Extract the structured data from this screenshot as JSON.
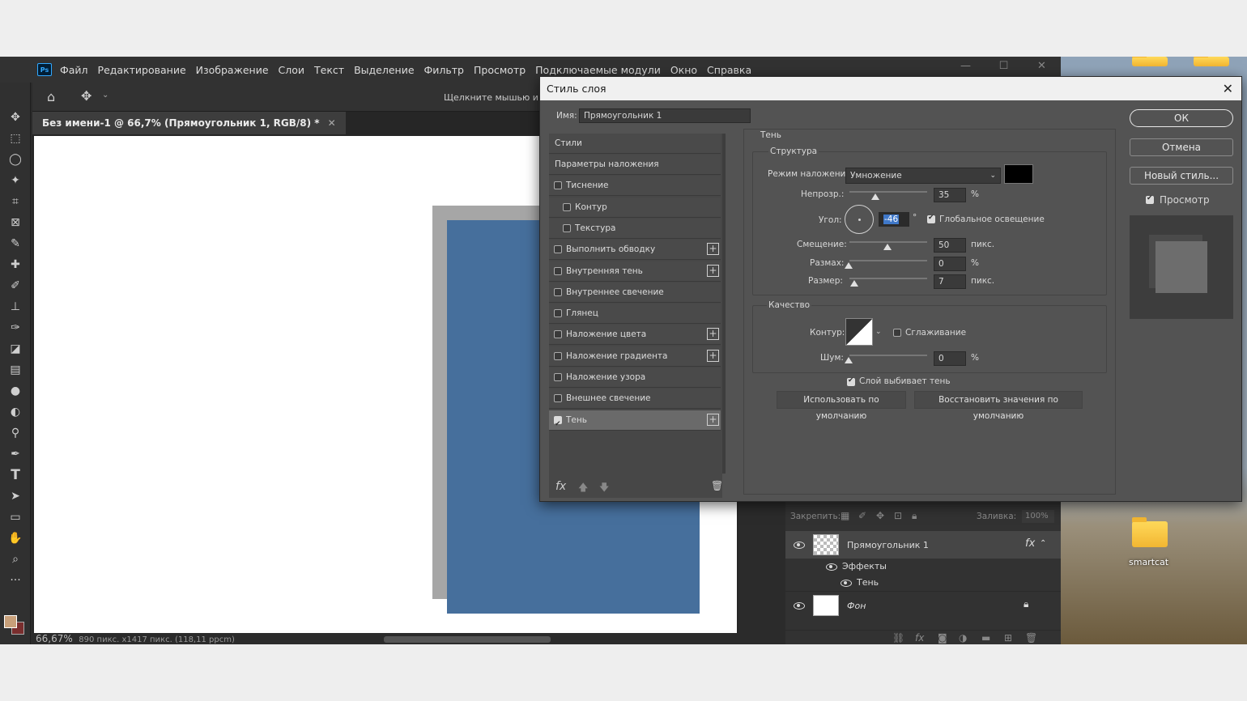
{
  "app": {
    "menu": [
      "Файл",
      "Редактирование",
      "Изображение",
      "Слои",
      "Текст",
      "Выделение",
      "Фильтр",
      "Просмотр",
      "Подключаемые модули",
      "Окно",
      "Справка"
    ],
    "options_hint": "Щелкните мышью и пере",
    "doc_tab": "Без имени-1 @ 66,7% (Прямоугольник 1, RGB/8) *",
    "status_zoom": "66,67%",
    "status_info": "890 пикс. x1417 пикс. (118,11 ppcm)"
  },
  "desktop": {
    "folder_label": "smartcat"
  },
  "layers": {
    "lock_label": "Закрепить:",
    "fill_label": "Заливка:",
    "fill_value": "100%",
    "items": [
      {
        "name": "Прямоугольник 1"
      },
      {
        "name": "Эффекты"
      },
      {
        "name": "Тень"
      },
      {
        "name": "Фон"
      }
    ]
  },
  "dialog": {
    "title": "Стиль слоя",
    "name_label": "Имя:",
    "name_value": "Прямоугольник 1",
    "styles": [
      {
        "label": "Стили"
      },
      {
        "label": "Параметры наложения"
      },
      {
        "label": "Тиснение",
        "checked": false
      },
      {
        "label": "Контур",
        "checked": false
      },
      {
        "label": "Текстура",
        "checked": false
      },
      {
        "label": "Выполнить обводку",
        "checked": false
      },
      {
        "label": "Внутренняя тень",
        "checked": false
      },
      {
        "label": "Внутреннее свечение",
        "checked": false
      },
      {
        "label": "Глянец",
        "checked": false
      },
      {
        "label": "Наложение цвета",
        "checked": false
      },
      {
        "label": "Наложение градиента",
        "checked": false
      },
      {
        "label": "Наложение узора",
        "checked": false
      },
      {
        "label": "Внешнее свечение",
        "checked": false
      },
      {
        "label": "Тень",
        "checked": true
      }
    ],
    "section_title": "Тень",
    "structure": {
      "title": "Структура",
      "blend_mode_label": "Режим наложения:",
      "blend_mode_value": "Умножение",
      "shadow_color": "#000000",
      "opacity_label": "Непрозр.:",
      "opacity_value": "35",
      "opacity_unit": "%",
      "angle_label": "Угол:",
      "angle_value": "-46",
      "angle_unit": "°",
      "global_light_label": "Глобальное освещение",
      "distance_label": "Смещение:",
      "distance_value": "50",
      "distance_unit": "пикс.",
      "spread_label": "Размах:",
      "spread_value": "0",
      "spread_unit": "%",
      "size_label": "Размер:",
      "size_value": "7",
      "size_unit": "пикс."
    },
    "quality": {
      "title": "Качество",
      "contour_label": "Контур:",
      "antialias_label": "Сглаживание",
      "noise_label": "Шум:",
      "noise_value": "0",
      "noise_unit": "%"
    },
    "knockout_label": "Слой выбивает тень",
    "make_default": "Использовать по умолчанию",
    "reset_default": "Восстановить значения по умолчанию",
    "ok": "ОК",
    "cancel": "Отмена",
    "new_style": "Новый стиль...",
    "preview_label": "Просмотр"
  }
}
